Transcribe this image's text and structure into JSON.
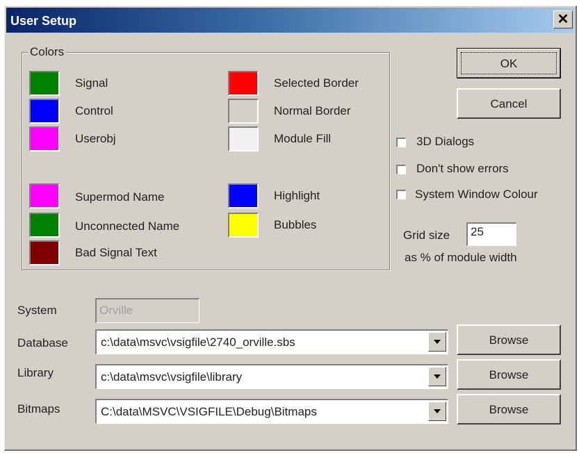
{
  "window": {
    "title": "User Setup",
    "close_glyph": "✕"
  },
  "colors_group": {
    "label": "Colors",
    "left_items": [
      {
        "label": "Signal",
        "color": "#008000"
      },
      {
        "label": "Control",
        "color": "#0000ff"
      },
      {
        "label": "Userobj",
        "color": "#ff00ff"
      },
      {
        "label": "Supermod Name",
        "color": "#ff00ff"
      },
      {
        "label": "Unconnected Name",
        "color": "#008000"
      },
      {
        "label": "Bad Signal Text",
        "color": "#800000"
      }
    ],
    "right_items": [
      {
        "label": "Selected Border",
        "color": "#ff0000"
      },
      {
        "label": "Normal Border",
        "color": "#d4d0c8"
      },
      {
        "label": "Module Fill",
        "color": "#f0f0f0"
      },
      {
        "label": "Highlight",
        "color": "#0000ff"
      },
      {
        "label": "Bubbles",
        "color": "#ffff00"
      }
    ]
  },
  "buttons": {
    "ok": "OK",
    "cancel": "Cancel",
    "browse": "Browse"
  },
  "options": {
    "dialogs_3d": {
      "label": "3D Dialogs",
      "checked": false
    },
    "dont_show_errors": {
      "label": "Don't show errors",
      "checked": false
    },
    "system_window_colour": {
      "label": "System Window Colour",
      "checked": false
    }
  },
  "grid": {
    "label": "Grid size",
    "value": "25",
    "caption": "as % of module width"
  },
  "paths": {
    "system": {
      "label": "System",
      "value": "Orville"
    },
    "database": {
      "label": "Database",
      "value": "c:\\data\\msvc\\vsigfile\\2740_orville.sbs"
    },
    "library": {
      "label": "Library",
      "value": "c:\\data\\msvc\\vsigfile\\library"
    },
    "bitmaps": {
      "label": "Bitmaps",
      "value": "C:\\data\\MSVC\\VSIGFILE\\Debug\\Bitmaps"
    }
  }
}
